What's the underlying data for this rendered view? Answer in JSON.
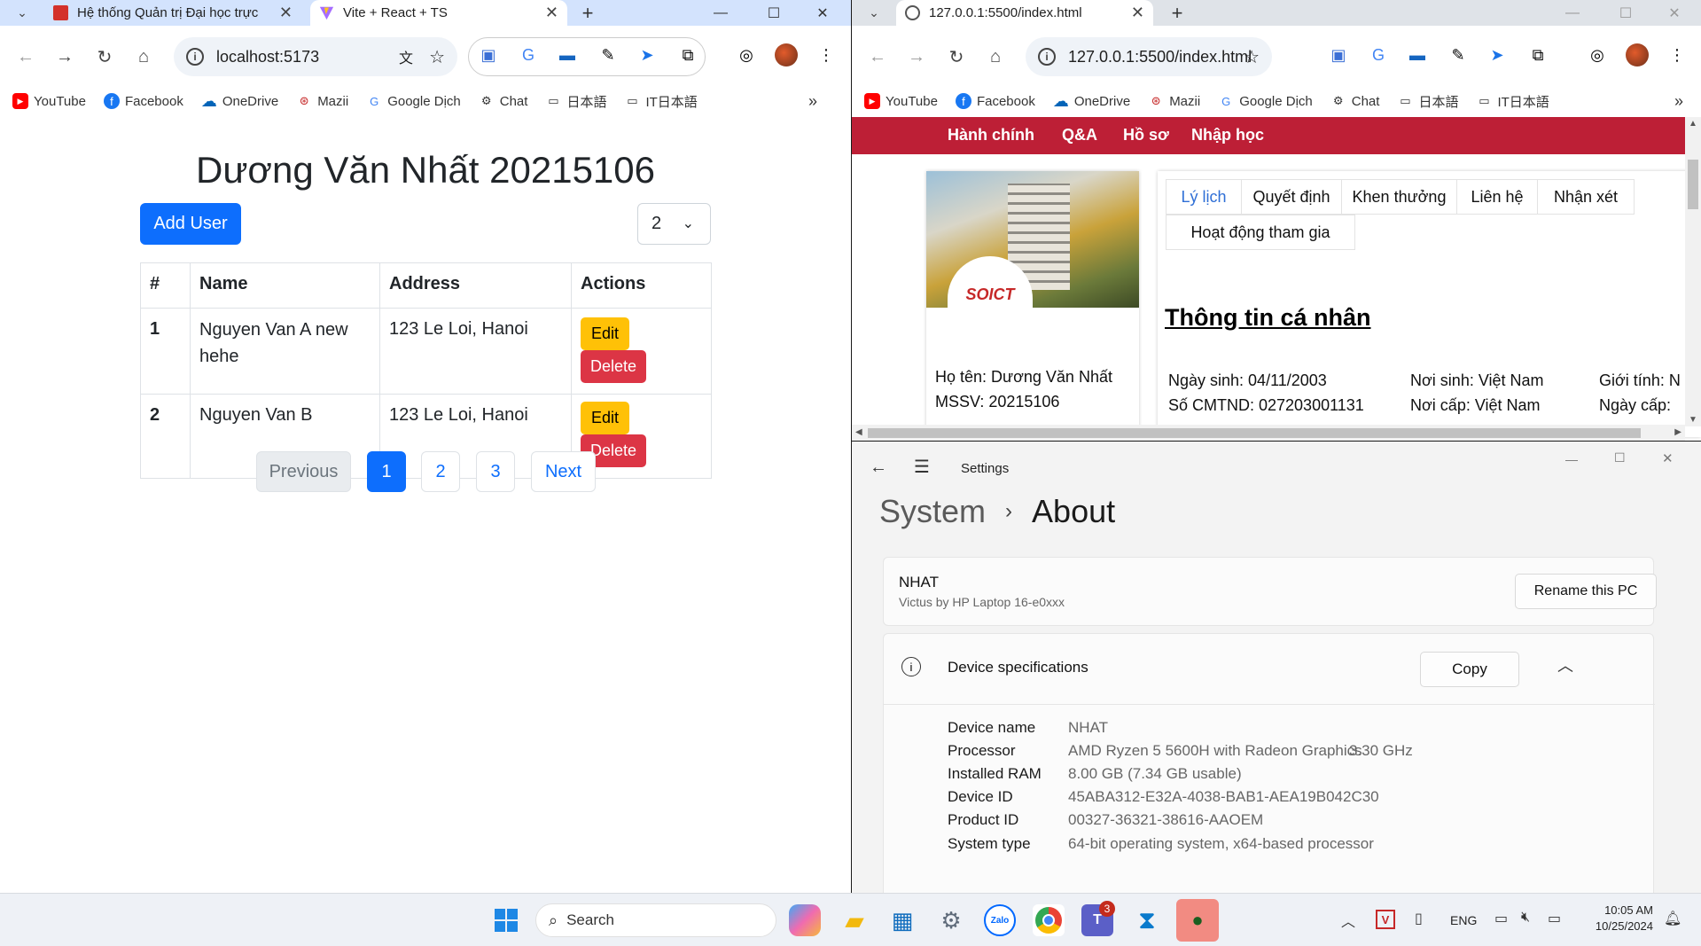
{
  "left_browser": {
    "tabs": [
      {
        "title": "Hệ thống Quản trị Đại học trực",
        "active": false
      },
      {
        "title": "Vite + React + TS",
        "active": true
      }
    ],
    "url": "localhost:5173",
    "bookmarks": [
      "YouTube",
      "Facebook",
      "OneDrive",
      "Mazii",
      "Google Dịch",
      "Chat",
      "日本語",
      "IT日本語"
    ],
    "page": {
      "title": "Dương Văn Nhất 20215106",
      "add_button": "Add User",
      "page_size": "2",
      "table": {
        "headers": [
          "#",
          "Name",
          "Address",
          "Actions"
        ],
        "rows": [
          {
            "id": "1",
            "name": "Nguyen Van A new hehe",
            "address": "123 Le Loi, Hanoi",
            "edit": "Edit",
            "delete": "Delete"
          },
          {
            "id": "2",
            "name": "Nguyen Van B",
            "address": "123 Le Loi, Hanoi",
            "edit": "Edit",
            "delete": "Delete"
          }
        ]
      },
      "pagination": {
        "previous": "Previous",
        "pages": [
          "1",
          "2",
          "3"
        ],
        "next": "Next",
        "current": "1"
      }
    }
  },
  "right_browser": {
    "tab": {
      "title": "127.0.0.1:5500/index.html"
    },
    "url": "127.0.0.1:5500/index.html",
    "bookmarks": [
      "YouTube",
      "Facebook",
      "OneDrive",
      "Mazii",
      "Google Dịch",
      "Chat",
      "日本語",
      "IT日本語"
    ],
    "page": {
      "nav": [
        "Hành chính",
        "Q&A",
        "Hồ sơ",
        "Nhập học"
      ],
      "logo_text": "SOICT",
      "name_line": "Họ tên: Dương Văn Nhất",
      "mssv_line": "MSSV: 20215106",
      "tabs": [
        "Lý lịch",
        "Quyết định",
        "Khen thưởng",
        "Liên hệ",
        "Nhận xét",
        "Hoạt động tham gia"
      ],
      "section_title": "Thông tin cá nhân",
      "info": {
        "dob": "Ngày sinh: 04/11/2003",
        "birthplace": "Nơi sinh: Việt Nam",
        "gender": "Giới tính: N",
        "id_no": "Số CMTND: 027203001131",
        "issue_place": "Nơi cấp: Việt Nam",
        "issue_date": "Ngày cấp:"
      }
    }
  },
  "settings": {
    "app_title": "Settings",
    "breadcrumb_parent": "System",
    "breadcrumb_current": "About",
    "pc_name": "NHAT",
    "pc_model": "Victus by HP Laptop 16-e0xxx",
    "rename_button": "Rename this PC",
    "device_specs_title": "Device specifications",
    "copy_button": "Copy",
    "specs": [
      {
        "label": "Device name",
        "value": "NHAT",
        "extra": ""
      },
      {
        "label": "Processor",
        "value": "AMD Ryzen 5 5600H with Radeon Graphics",
        "extra": "3.30 GHz"
      },
      {
        "label": "Installed RAM",
        "value": "8.00 GB (7.34 GB usable)",
        "extra": ""
      },
      {
        "label": "Device ID",
        "value": "45ABA312-E32A-4038-BAB1-AEA19B042C30",
        "extra": ""
      },
      {
        "label": "Product ID",
        "value": "00327-36321-38616-AAOEM",
        "extra": ""
      },
      {
        "label": "System type",
        "value": "64-bit operating system, x64-based processor",
        "extra": ""
      }
    ]
  },
  "taskbar": {
    "search_placeholder": "Search",
    "teams_badge": "3",
    "language": "ENG",
    "time": "10:05 AM",
    "date": "10/25/2024"
  },
  "colors": {
    "primary": "#0d6efd",
    "warning": "#ffc107",
    "danger": "#dc3545",
    "soict_red": "#bd1f36",
    "tab_strip_active": "#d3e3fd"
  }
}
